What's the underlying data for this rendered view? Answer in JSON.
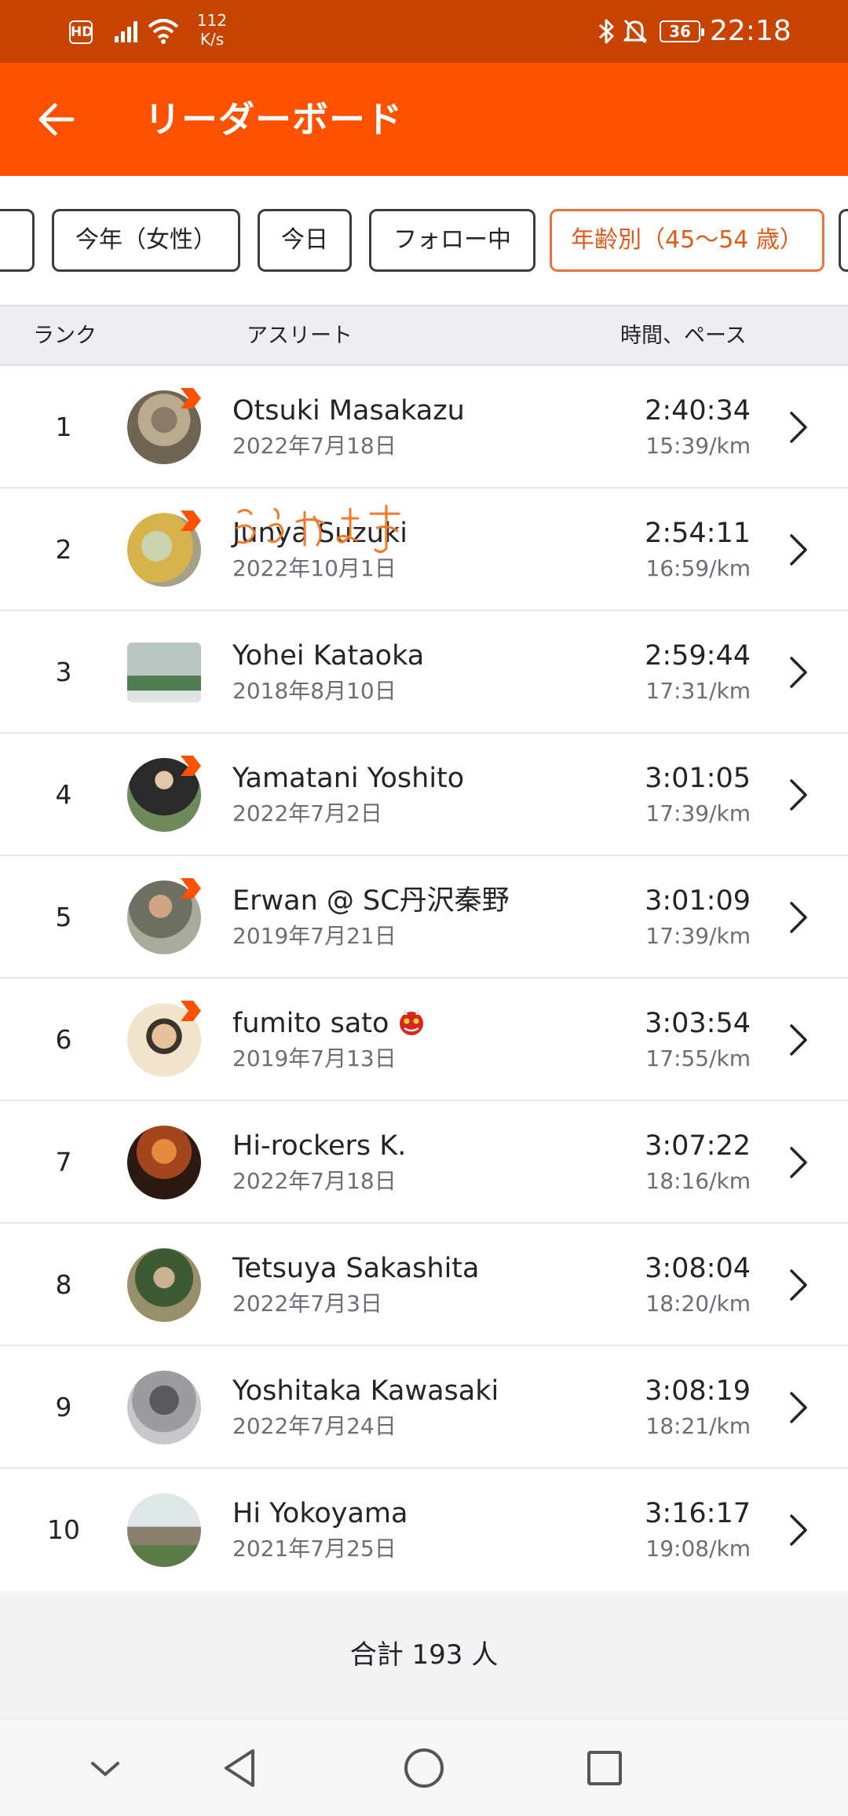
{
  "status_bar": {
    "hd": "HD",
    "speed_value": "112",
    "speed_unit": "K/s",
    "battery": "36",
    "time": "22:18"
  },
  "app_bar": {
    "title": "リーダーボード"
  },
  "filters": [
    {
      "label": "今年（女性）",
      "active": false
    },
    {
      "label": "今日",
      "active": false
    },
    {
      "label": "フォロー中",
      "active": false
    },
    {
      "label": "年齢別（45〜54 歳）",
      "active": true
    }
  ],
  "table_header": {
    "rank": "ランク",
    "athlete": "アスリート",
    "time_pace": "時間、ペース"
  },
  "rows": [
    {
      "rank": "1",
      "name": "Otsuki Masakazu",
      "date": "2022年7月18日",
      "time": "2:40:34",
      "pace": "15:39/km"
    },
    {
      "rank": "2",
      "name": "Junya Suzuki",
      "date": "2022年10月1日",
      "time": "2:54:11",
      "pace": "16:59/km"
    },
    {
      "rank": "3",
      "name": "Yohei Kataoka",
      "date": "2018年8月10日",
      "time": "2:59:44",
      "pace": "17:31/km"
    },
    {
      "rank": "4",
      "name": "Yamatani Yoshito",
      "date": "2022年7月2日",
      "time": "3:01:05",
      "pace": "17:39/km"
    },
    {
      "rank": "5",
      "name": "Erwan @ SC丹沢秦野",
      "date": "2019年7月21日",
      "time": "3:01:09",
      "pace": "17:39/km"
    },
    {
      "rank": "6",
      "name": "fumito sato",
      "date": "2019年7月13日",
      "time": "3:03:54",
      "pace": "17:55/km"
    },
    {
      "rank": "7",
      "name": "Hi-rockers K.",
      "date": "2022年7月18日",
      "time": "3:07:22",
      "pace": "18:16/km"
    },
    {
      "rank": "8",
      "name": "Tetsuya Sakashita",
      "date": "2022年7月3日",
      "time": "3:08:04",
      "pace": "18:20/km"
    },
    {
      "rank": "9",
      "name": "Yoshitaka Kawasaki",
      "date": "2022年7月24日",
      "time": "3:08:19",
      "pace": "18:21/km"
    },
    {
      "rank": "10",
      "name": "Hi Yokoyama",
      "date": "2021年7月25日",
      "time": "3:16:17",
      "pace": "19:08/km"
    }
  ],
  "handwriting": "ふらやす",
  "total": "合計 193 人",
  "colors": {
    "brand": "#fc5200",
    "status_bar": "#c84300",
    "active_chip": "#e05a1a",
    "badge": "#fc5200"
  },
  "icons": {
    "back": "arrow-left-icon",
    "row_chevron": "chevron-right-icon",
    "badge": "subscriber-badge-icon",
    "nav": [
      "chevron-down-icon",
      "back-triangle-icon",
      "home-circle-icon",
      "recents-square-icon"
    ]
  }
}
